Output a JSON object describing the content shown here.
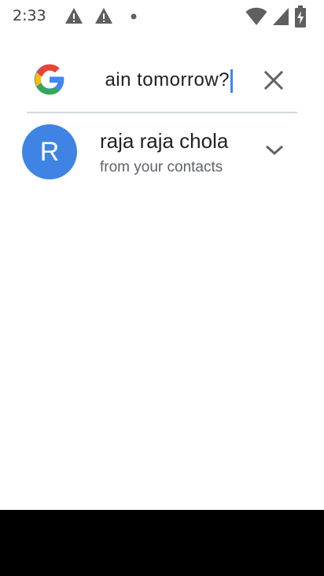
{
  "status_bar": {
    "time": "2:33",
    "left_icons": [
      "warning-icon",
      "warning-icon",
      "dot-icon"
    ],
    "right_icons": [
      "wifi-icon",
      "signal-icon",
      "battery-charging-icon"
    ]
  },
  "search": {
    "logo": "google-g-icon",
    "query_visible": "ain tomorrow?",
    "clear_icon": "close-icon"
  },
  "suggestions": [
    {
      "avatar_letter": "R",
      "title": "raja raja chola",
      "subtitle": "from your contacts",
      "expand_icon": "chevron-down-icon"
    }
  ],
  "colors": {
    "accent": "#4285f4",
    "avatar": "#3f84e5",
    "nav_bar": "#000000"
  }
}
